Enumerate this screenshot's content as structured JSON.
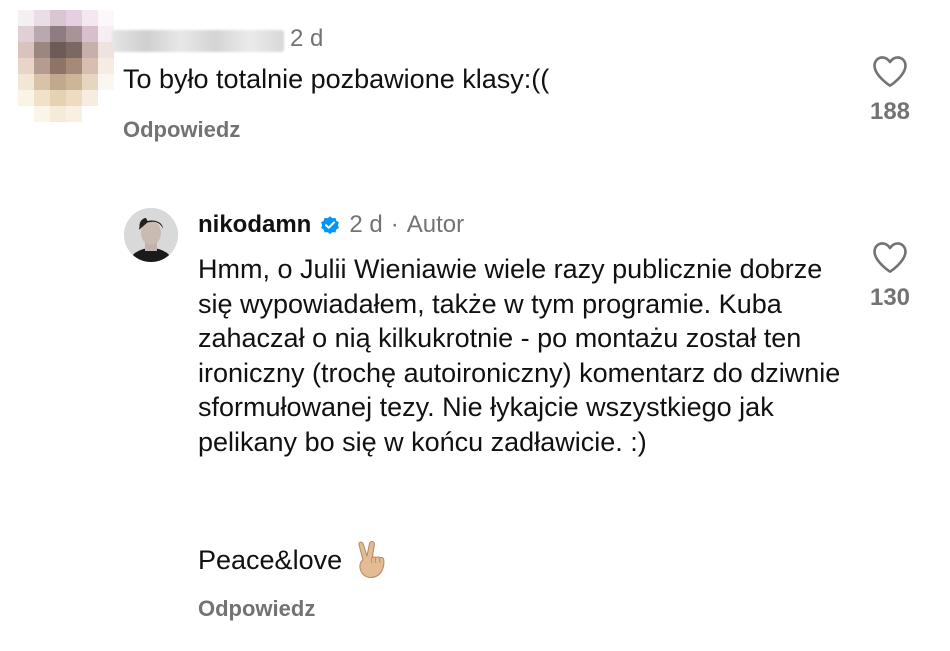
{
  "comments": [
    {
      "time": "2 d",
      "text": "To było totalnie pozbawione klasy:((",
      "reply_label": "Odpowiedz",
      "likes": "188"
    },
    {
      "username": "nikodamn",
      "time": "2 d",
      "separator": "·",
      "author_badge": "Autor",
      "text": "Hmm, o Julii Wieniawie wiele razy publicznie dobrze się wypowiadałem, także w tym programie. Kuba zahaczał o nią kilkukrotnie - po montażu został ten ironiczny (trochę autoironiczny) komentarz do dziwnie sformułowanej tezy. Nie łykajcie wszystkiego jak pelikany bo się w końcu zadławicie. :)",
      "closing": "Peace&love",
      "reply_label": "Odpowiedz",
      "likes": "130"
    }
  ],
  "colors": {
    "text": "#111111",
    "secondary": "#737373",
    "verified": "#0095f6"
  },
  "icons": {
    "like": "heart-outline-icon",
    "verified": "verified-badge-icon",
    "closing_emoji": "victory-hand-emoji-icon"
  }
}
